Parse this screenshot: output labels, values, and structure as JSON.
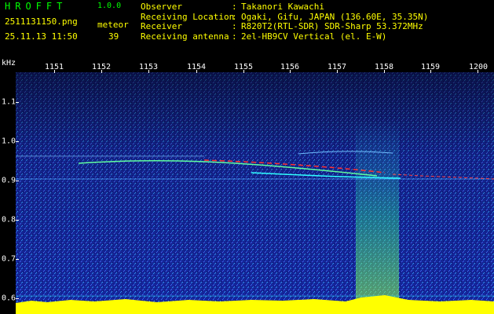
{
  "header": {
    "app_title": "HROFFT",
    "app_version": "1.0.0",
    "filename": "2511131150.png",
    "datetime": "25.11.13 11:50",
    "meteor_label": "meteor",
    "meteor_count": "39",
    "info": [
      {
        "key": "Observer",
        "value": "Takanori Kawachi"
      },
      {
        "key": "Receiving Location",
        "value": "Ogaki, Gifu, JAPAN (136.60E, 35.35N)"
      },
      {
        "key": "Receiver",
        "value": "R820T2(RTL-SDR) SDR-Sharp 53.372MHz"
      },
      {
        "key": "Receiving antenna",
        "value": "2el-HB9CV Vertical (el. E-W)"
      }
    ],
    "separator": ":"
  },
  "axis": {
    "y_unit": "kHz",
    "x_minute_labels": [
      "1151",
      "1152",
      "1153",
      "1154",
      "1155",
      "1156",
      "1157",
      "1158",
      "1159",
      "1200"
    ],
    "y_tick_labels": [
      "1.1",
      "1.0",
      "0.9",
      "0.8",
      "0.7",
      "0.6"
    ]
  },
  "colors": {
    "background_noise": "#1a2fb0",
    "accent_green": "#00ff00",
    "text_yellow": "#ffff00",
    "signal_red": "#ff2020",
    "bottom_band": "#ffff00"
  }
}
